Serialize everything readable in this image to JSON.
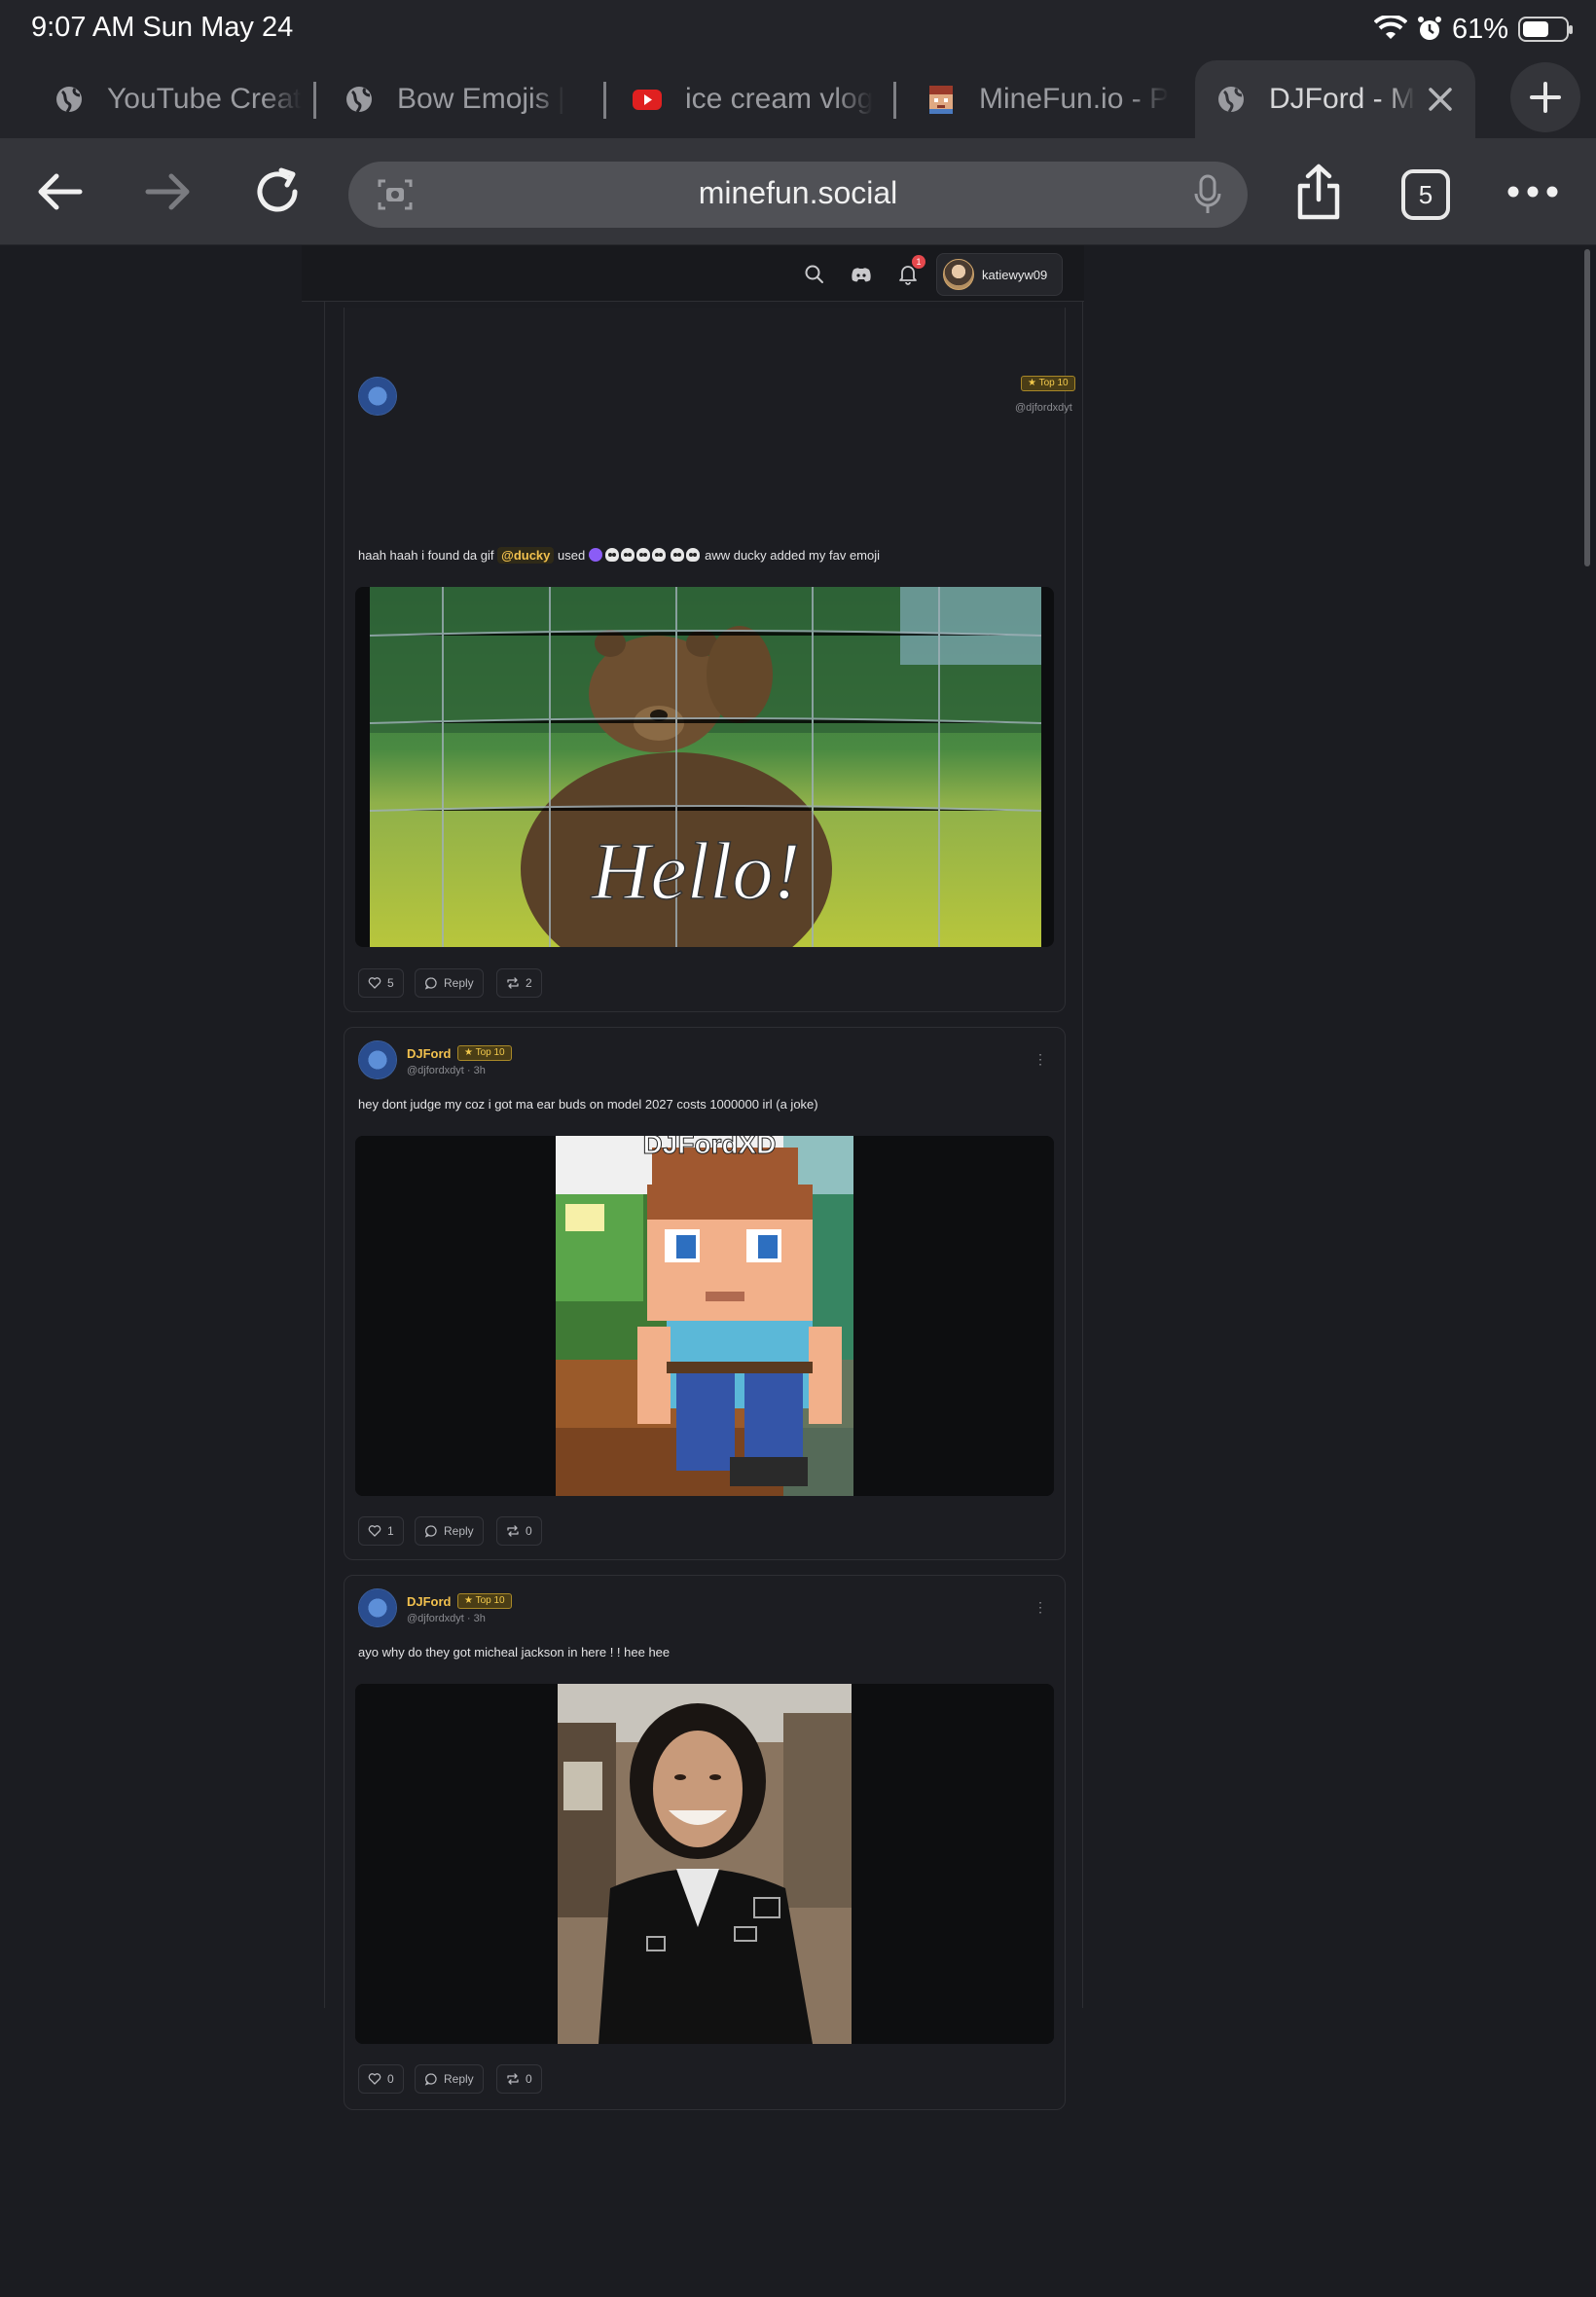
{
  "status_bar": {
    "time_date": "9:07 AM   Sun May 24",
    "battery": "61%",
    "battery_level": 0.61
  },
  "browser": {
    "tabs": [
      {
        "label": "YouTube Creat",
        "icon": "globe-icon"
      },
      {
        "label": "Bow Emojis | ",
        "icon": "globe-icon"
      },
      {
        "label": "ice cream vlog",
        "icon": "youtube-icon"
      },
      {
        "label": "MineFun.io - P",
        "icon": "minefun-favicon"
      },
      {
        "label": "DJFord - M",
        "icon": "globe-icon",
        "active": true
      }
    ],
    "url": "minefun.social",
    "tab_count": "5"
  },
  "site_nav": {
    "username": "katiewyw09",
    "notification_count": "1"
  },
  "posts": [
    {
      "badge": "★ Top 10",
      "handle": "@djfordxdyt",
      "text_before": "haah haah i found da gif",
      "mention": "@ducky",
      "text_after": "aww ducky added my fav emoji",
      "text_used": "used",
      "media_caption": "Hello!",
      "likes": "5",
      "reply": "Reply",
      "reposts": "2"
    },
    {
      "name": "DJFord",
      "badge": "★ Top 10",
      "handle": "@djfordxdyt · 3h",
      "text": "hey dont judge my coz i got ma ear buds on model 2027 costs 1000000 irl (a joke)",
      "media_caption": "DJFordXD",
      "likes": "1",
      "reply": "Reply",
      "reposts": "0"
    },
    {
      "name": "DJFord",
      "badge": "★ Top 10",
      "handle": "@djfordxdyt · 3h",
      "text": "ayo why do they got micheal jackson in here ! ! hee hee",
      "likes": "0",
      "reply": "Reply",
      "reposts": "0"
    }
  ]
}
